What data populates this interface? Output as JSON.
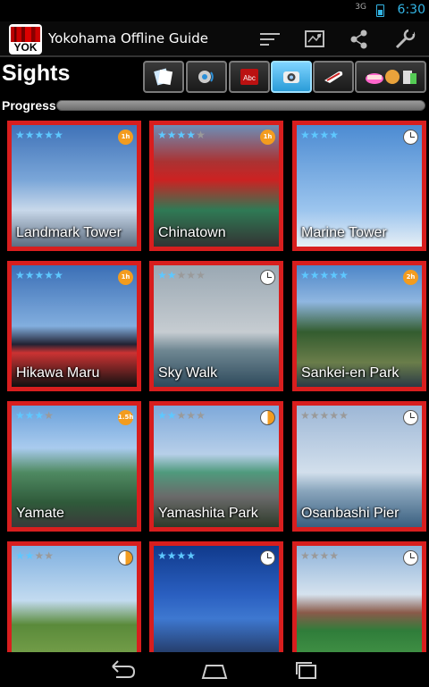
{
  "status_bar": {
    "signal": "3G",
    "time": "6:30"
  },
  "action_bar": {
    "logo_text": "YOK",
    "title": "Yokohama Offline Guide",
    "icons": [
      "sort-icon",
      "map-icon",
      "share-icon",
      "settings-wrench-icon"
    ]
  },
  "header": {
    "title": "Sights"
  },
  "categories": [
    {
      "icon": "guide-papers-icon",
      "active": false
    },
    {
      "icon": "audio-guide-icon",
      "active": false
    },
    {
      "icon": "dictionary-icon",
      "active": false,
      "label": "Abc"
    },
    {
      "icon": "sights-camera-icon",
      "active": true
    },
    {
      "icon": "train-icon",
      "active": false
    },
    {
      "icon": "food-icon",
      "active": false
    }
  ],
  "progress": {
    "label": "Progress",
    "value": 0.0
  },
  "sights": [
    {
      "name": "Landmark Tower",
      "stars": 5,
      "rated": 5,
      "badge": "1h",
      "badge_type": "orange"
    },
    {
      "name": "Chinatown",
      "stars": 4,
      "rated": 5,
      "badge": "1h",
      "badge_type": "orange"
    },
    {
      "name": "Marine Tower",
      "stars": 4,
      "rated": 4,
      "badge": "",
      "badge_type": "clock"
    },
    {
      "name": "Hikawa Maru",
      "stars": 5,
      "rated": 5,
      "badge": "1h",
      "badge_type": "orange"
    },
    {
      "name": "Sky Walk",
      "stars": 2,
      "rated": 5,
      "badge": "",
      "badge_type": "clock"
    },
    {
      "name": "Sankei-en Park",
      "stars": 5,
      "rated": 5,
      "badge": "2h",
      "badge_type": "orange"
    },
    {
      "name": "Yamate",
      "stars": 3,
      "rated": 4,
      "badge": "1.5h",
      "badge_type": "orange"
    },
    {
      "name": "Yamashita Park",
      "stars": 2,
      "rated": 5,
      "badge": "",
      "badge_type": "half"
    },
    {
      "name": "Osanbashi Pier",
      "stars": 0,
      "rated": 5,
      "badge": "",
      "badge_type": "clock"
    },
    {
      "name": "",
      "stars": 2,
      "rated": 4,
      "badge": "",
      "badge_type": "half"
    },
    {
      "name": "",
      "stars": 4,
      "rated": 4,
      "badge": "",
      "badge_type": "clock"
    },
    {
      "name": "",
      "stars": 0,
      "rated": 4,
      "badge": "",
      "badge_type": "clock"
    }
  ],
  "nav": [
    "back-icon",
    "home-icon",
    "recent-apps-icon"
  ],
  "colors": {
    "accent": "#33b5e5",
    "tile_border": "#d81e1e",
    "badge": "#f39c1f"
  }
}
